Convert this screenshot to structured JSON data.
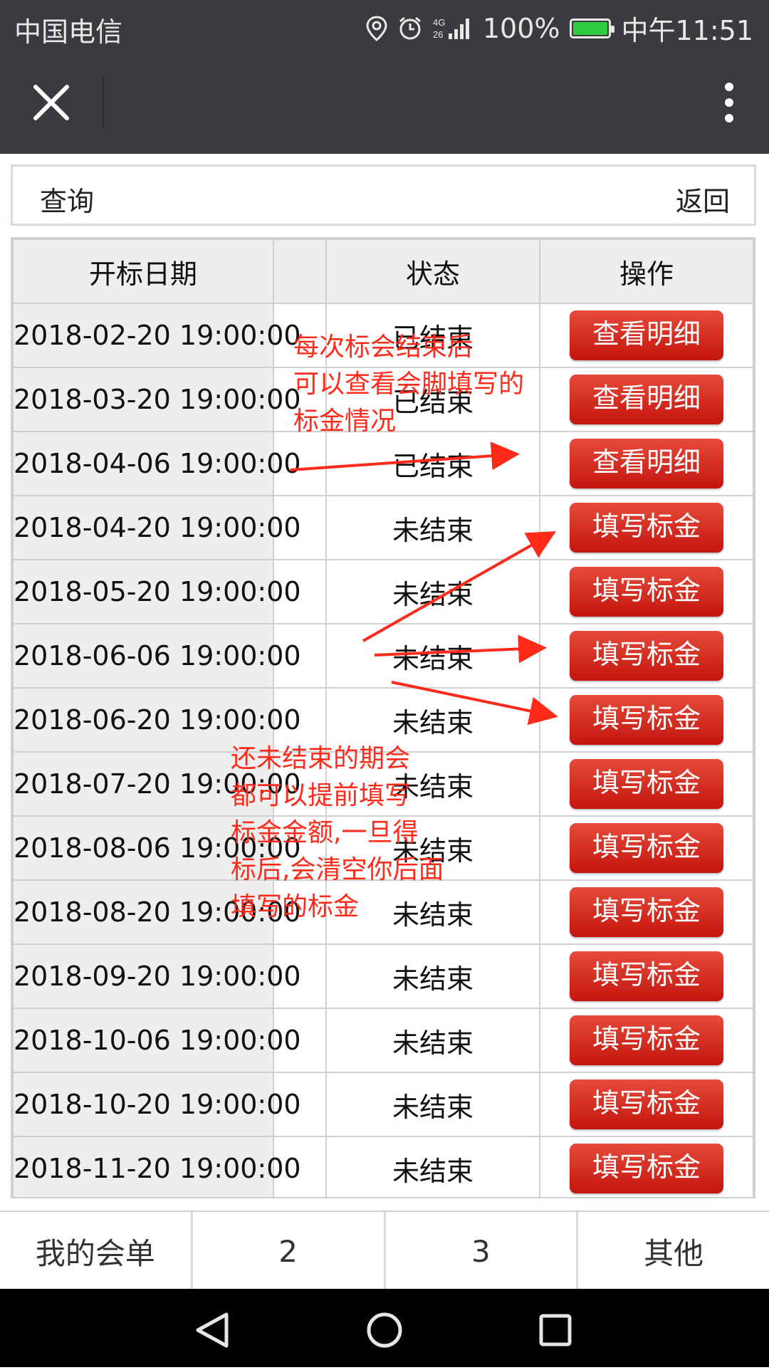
{
  "status_bar": {
    "carrier": "中国电信",
    "network": "4G 26",
    "battery": "100%",
    "time": "中午11:51"
  },
  "query_bar": {
    "query_label": "查询",
    "back_label": "返回"
  },
  "table": {
    "headers": [
      "开标日期",
      "",
      "状态",
      "操作"
    ],
    "rows": [
      {
        "date": "2018-02-20 19:00:00",
        "status": "已结束",
        "action": "查看明细"
      },
      {
        "date": "2018-03-20 19:00:00",
        "status": "已结束",
        "action": "查看明细"
      },
      {
        "date": "2018-04-06 19:00:00",
        "status": "已结束",
        "action": "查看明细"
      },
      {
        "date": "2018-04-20 19:00:00",
        "status": "未结束",
        "action": "填写标金"
      },
      {
        "date": "2018-05-20 19:00:00",
        "status": "未结束",
        "action": "填写标金"
      },
      {
        "date": "2018-06-06 19:00:00",
        "status": "未结束",
        "action": "填写标金"
      },
      {
        "date": "2018-06-20 19:00:00",
        "status": "未结束",
        "action": "填写标金"
      },
      {
        "date": "2018-07-20 19:00:00",
        "status": "未结束",
        "action": "填写标金"
      },
      {
        "date": "2018-08-06 19:00:00",
        "status": "未结束",
        "action": "填写标金"
      },
      {
        "date": "2018-08-20 19:00:00",
        "status": "未结束",
        "action": "填写标金"
      },
      {
        "date": "2018-09-20 19:00:00",
        "status": "未结束",
        "action": "填写标金"
      },
      {
        "date": "2018-10-06 19:00:00",
        "status": "未结束",
        "action": "填写标金"
      },
      {
        "date": "2018-10-20 19:00:00",
        "status": "未结束",
        "action": "填写标金"
      },
      {
        "date": "2018-11-20 19:00:00",
        "status": "未结束",
        "action": "填写标金"
      }
    ]
  },
  "annotations": {
    "note1": "每次标会结束后\n可以查看会脚填写的\n标金情况",
    "note2": "还未结束的期会\n都可以提前填写\n标金金额,一旦得\n标后,会清空你后面\n填写的标金"
  },
  "tabs": [
    "我的会单",
    "2",
    "3",
    "其他"
  ],
  "colors": {
    "button_red": "#d2231a",
    "annotation_red": "#ff2a1a",
    "header_bg": "#3a3b3f"
  },
  "icons": [
    "location-icon",
    "alarm-icon",
    "signal-icon",
    "battery-icon",
    "close-icon",
    "more-icon",
    "back-nav-icon",
    "home-nav-icon",
    "recent-nav-icon"
  ]
}
